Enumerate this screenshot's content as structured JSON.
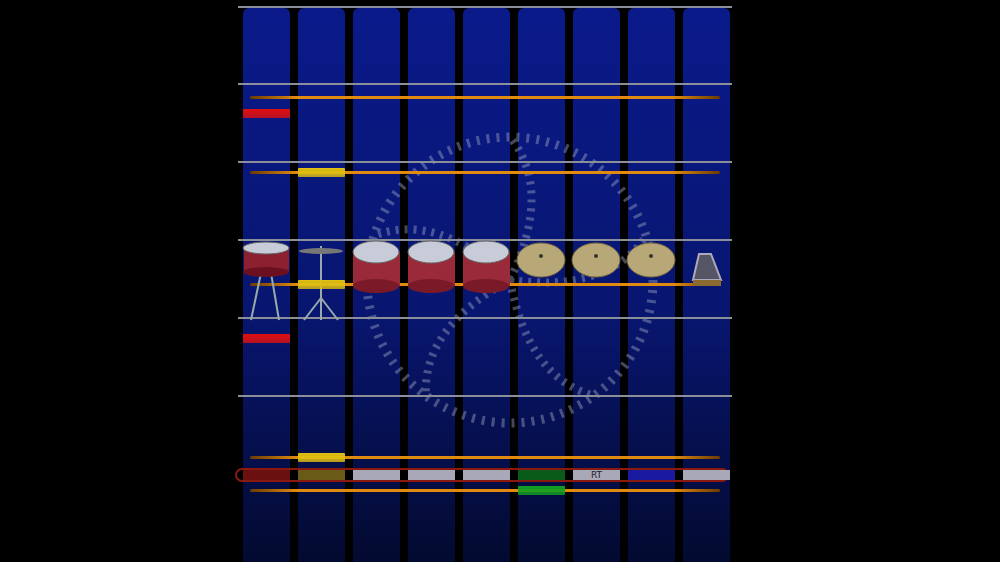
{
  "lanes": [
    {
      "pad": "snare",
      "chip_color": "#6a1010",
      "chip_label": ""
    },
    {
      "pad": "hihat",
      "chip_color": "#6a5a18",
      "chip_label": ""
    },
    {
      "pad": "tom",
      "chip_color": "#a8a8b8",
      "chip_label": ""
    },
    {
      "pad": "tom",
      "chip_color": "#a8a8b8",
      "chip_label": ""
    },
    {
      "pad": "tom",
      "chip_color": "#a8a8b8",
      "chip_label": ""
    },
    {
      "pad": "cymbal",
      "chip_color": "#0a5a1a",
      "chip_label": ""
    },
    {
      "pad": "cymbal",
      "chip_color": "#a8a8b8",
      "chip_label": "RT"
    },
    {
      "pad": "cymbal",
      "chip_color": "#1a1aa0",
      "chip_label": ""
    },
    {
      "pad": "bell",
      "chip_color": "#a8a8b8",
      "chip_label": ""
    }
  ],
  "notes": [
    {
      "lane": 0,
      "time": 0.955,
      "color": "#e01010"
    },
    {
      "lane": 0,
      "time": 0.363,
      "color": "#e01010"
    },
    {
      "lane": 1,
      "time": 0.8,
      "color": "#e0c010"
    },
    {
      "lane": 1,
      "time": 0.505,
      "color": "#e0c010"
    },
    {
      "lane": 1,
      "time": 0.05,
      "color": "#e0c010"
    },
    {
      "lane": 5,
      "time": -0.037,
      "color": "#10a020"
    }
  ]
}
